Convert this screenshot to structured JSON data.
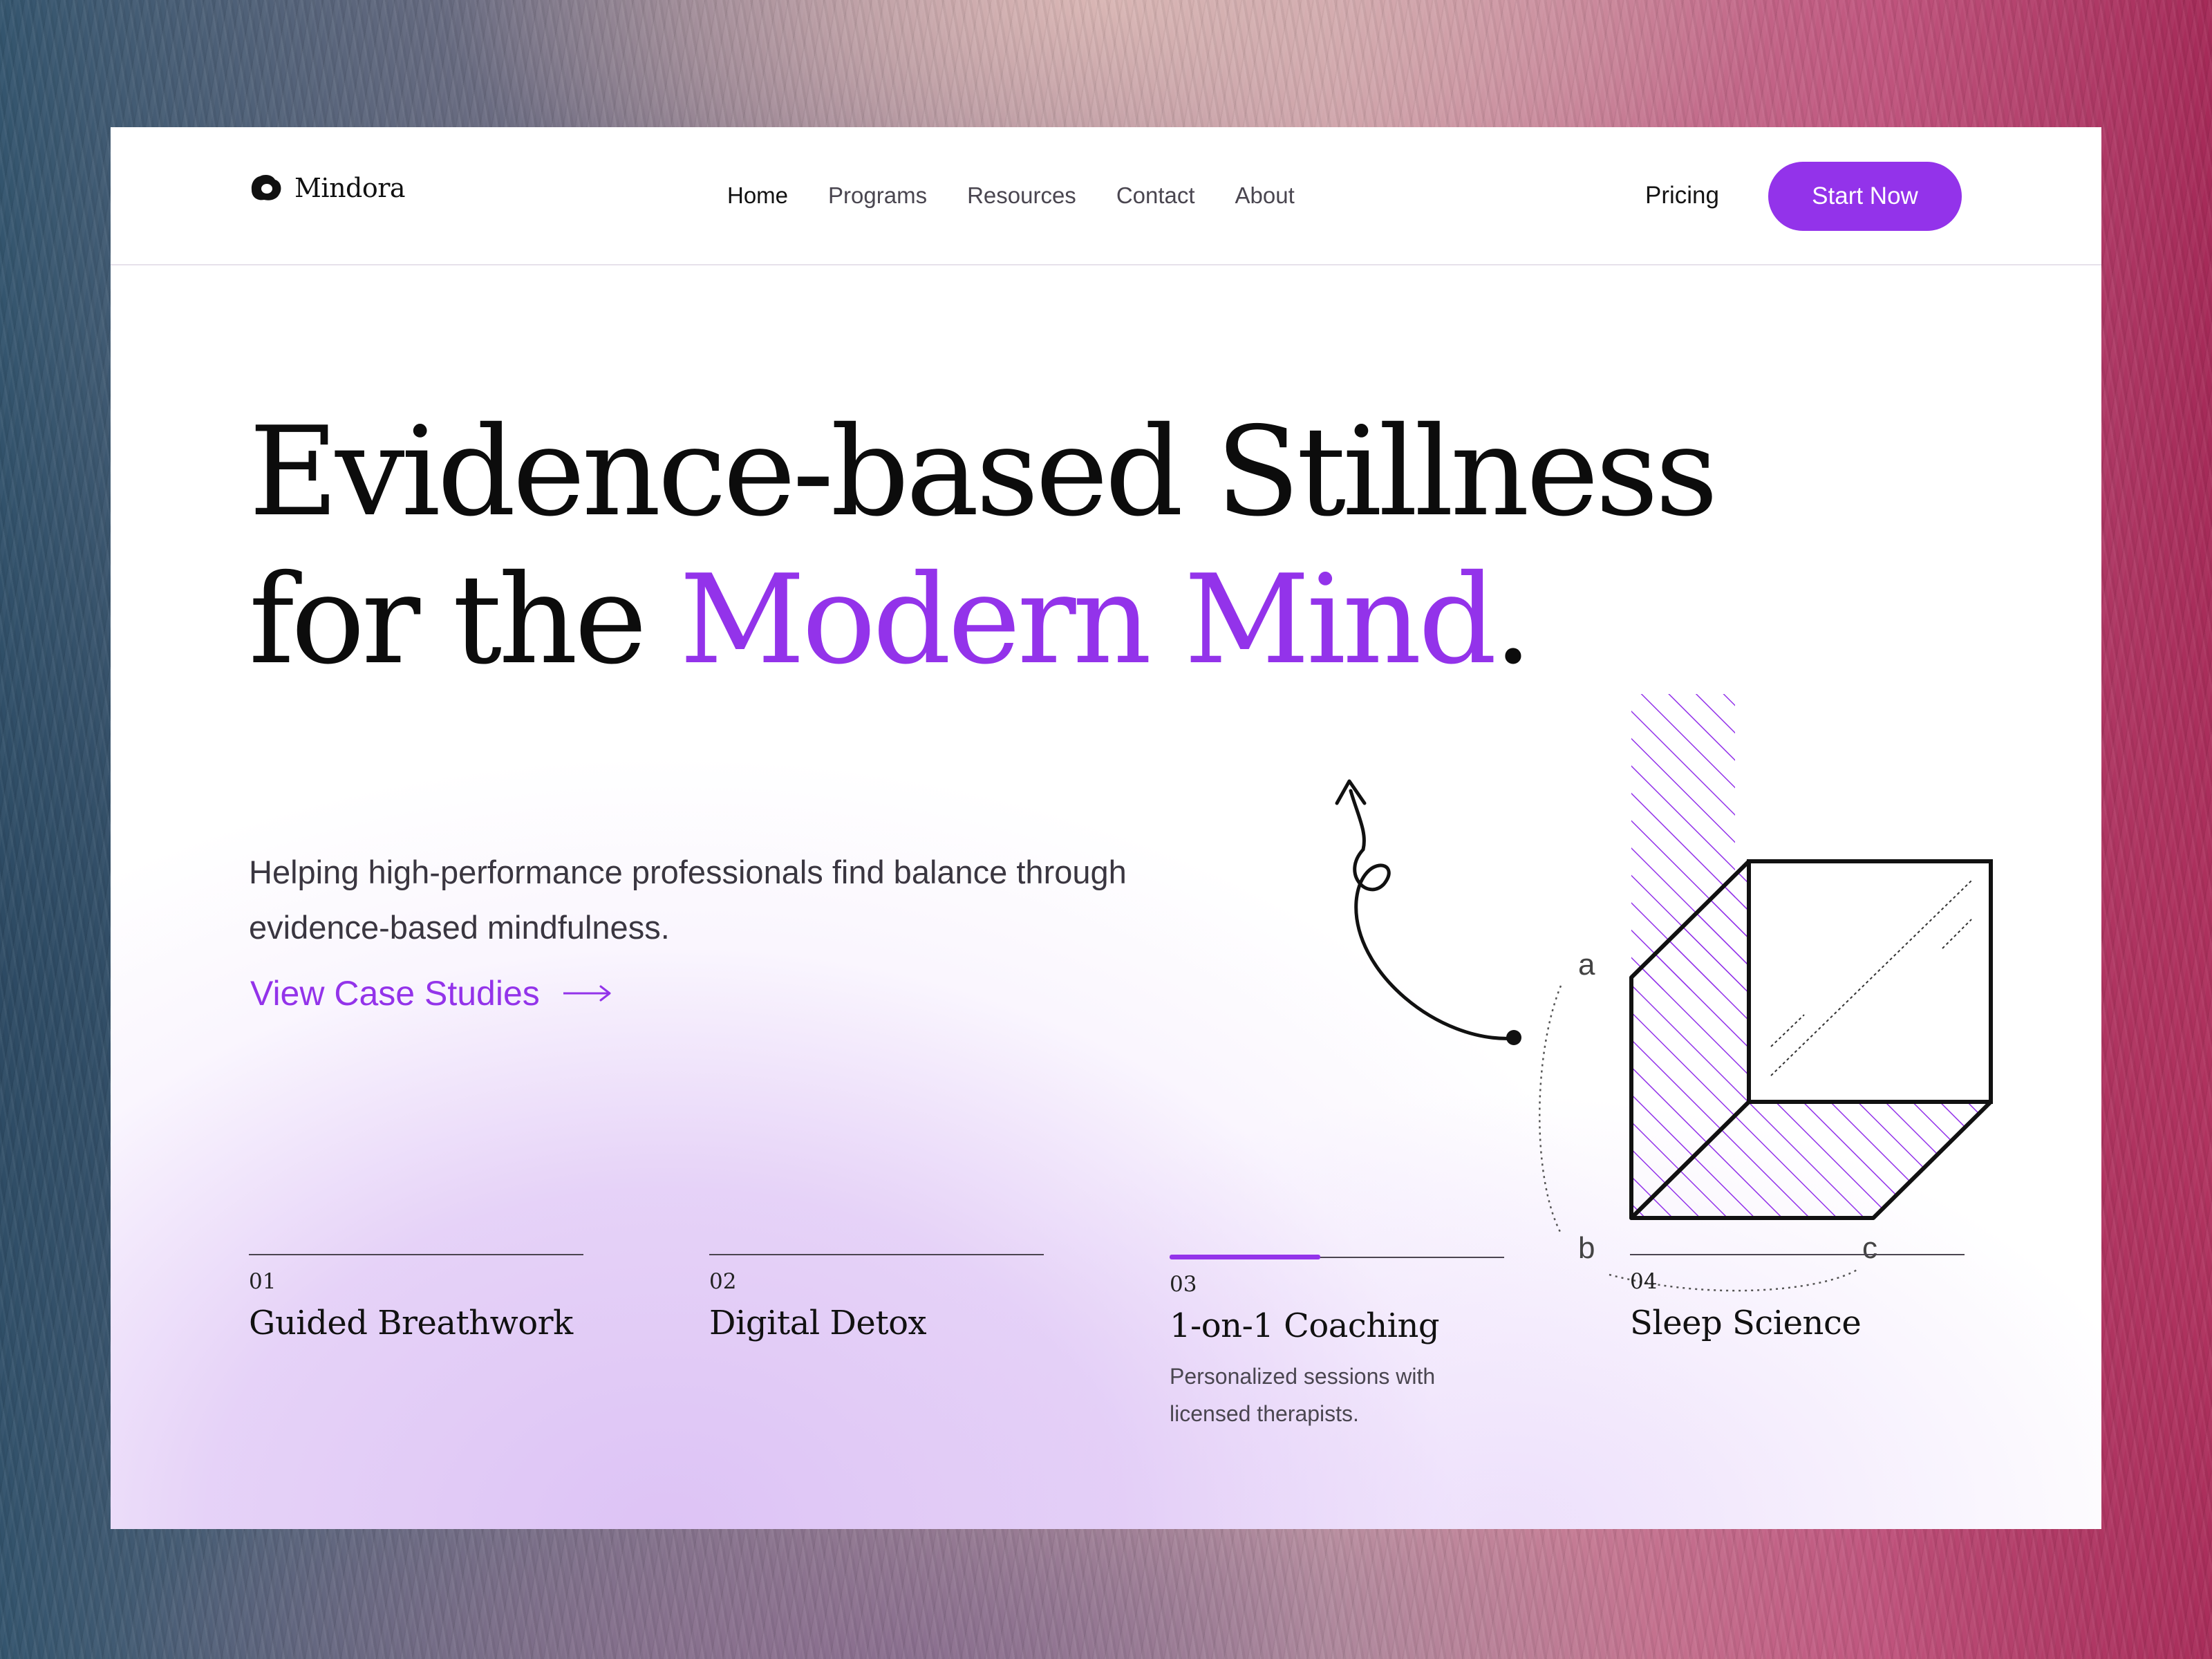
{
  "brand": {
    "name": "Mindora",
    "icon": "cloud-blob-icon"
  },
  "nav": {
    "links": [
      {
        "label": "Home",
        "active": true
      },
      {
        "label": "Programs",
        "active": false
      },
      {
        "label": "Resources",
        "active": false
      },
      {
        "label": "Contact",
        "active": false
      },
      {
        "label": "About",
        "active": false
      }
    ],
    "pricing_label": "Pricing",
    "cta_label": "Start Now"
  },
  "hero": {
    "title_line1": "Evidence-based Stillness",
    "title_line2_prefix": "for the ",
    "title_line2_accent": "Modern Mind",
    "title_line2_suffix": ".",
    "subtitle": "Helping high-performance professionals find balance through evidence-based mindfulness.",
    "link_label": "View Case Studies",
    "link_icon": "arrow-right-icon"
  },
  "illustration": {
    "labels": {
      "a": "a",
      "b": "b",
      "c": "c"
    },
    "icons": [
      "curly-arrow-icon",
      "cube-diagram"
    ]
  },
  "features": [
    {
      "number": "01",
      "title": "Guided Breathwork",
      "description": "",
      "progress": 0
    },
    {
      "number": "02",
      "title": "Digital Detox",
      "description": "",
      "progress": 0
    },
    {
      "number": "03",
      "title": "1-on-1 Coaching",
      "description": "Personalized sessions with licensed therapists.",
      "progress": 0.45
    },
    {
      "number": "04",
      "title": "Sleep Science",
      "description": "",
      "progress": 0
    }
  ],
  "colors": {
    "accent": "#9333ea",
    "text": "#0c0c0c",
    "muted": "#4a4650"
  }
}
